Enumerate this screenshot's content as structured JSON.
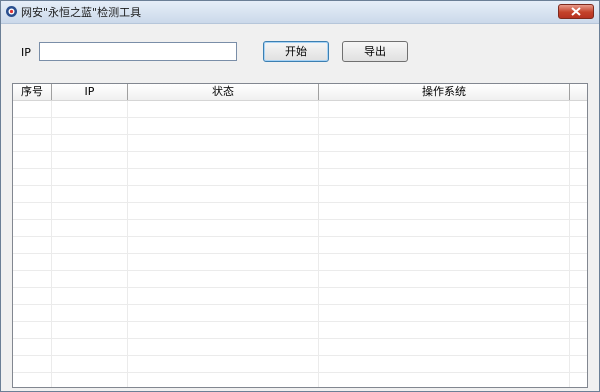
{
  "window": {
    "title": "网安\"永恒之蓝\"检测工具"
  },
  "form": {
    "ip_label": "IP",
    "ip_value": "",
    "start_label": "开始",
    "export_label": "导出"
  },
  "table": {
    "columns": [
      "序号",
      "IP",
      "状态",
      "操作系统"
    ],
    "rows": []
  },
  "colors": {
    "titlebar": "#cbd9ea",
    "close": "#c4422a",
    "accent": "#3c7fb1"
  }
}
